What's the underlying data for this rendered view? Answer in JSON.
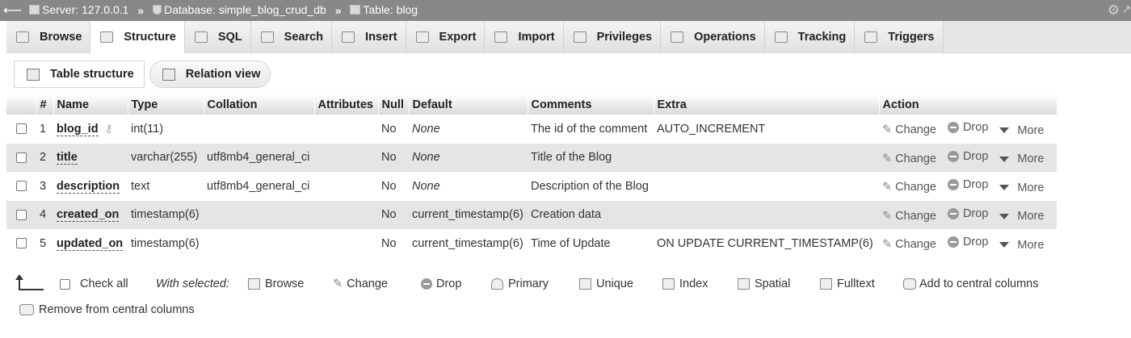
{
  "breadcrumb": {
    "back_icon": "arrow-left-icon",
    "server": "Server: 127.0.0.1",
    "database": "Database: simple_blog_crud_db",
    "table": "Table: blog",
    "separator": "»"
  },
  "tabs": [
    {
      "label": "Browse",
      "icon": "browse-icon",
      "active": false
    },
    {
      "label": "Structure",
      "icon": "structure-icon",
      "active": true
    },
    {
      "label": "SQL",
      "icon": "sql-icon",
      "active": false
    },
    {
      "label": "Search",
      "icon": "search-icon",
      "active": false
    },
    {
      "label": "Insert",
      "icon": "insert-icon",
      "active": false
    },
    {
      "label": "Export",
      "icon": "export-icon",
      "active": false
    },
    {
      "label": "Import",
      "icon": "import-icon",
      "active": false
    },
    {
      "label": "Privileges",
      "icon": "privileges-icon",
      "active": false
    },
    {
      "label": "Operations",
      "icon": "wrench-icon",
      "active": false
    },
    {
      "label": "Tracking",
      "icon": "eye-icon",
      "active": false
    },
    {
      "label": "Triggers",
      "icon": "triggers-icon",
      "active": false
    }
  ],
  "subnav": {
    "table_structure": "Table structure",
    "relation_view": "Relation view"
  },
  "table": {
    "headers": [
      "#",
      "Name",
      "Type",
      "Collation",
      "Attributes",
      "Null",
      "Default",
      "Comments",
      "Extra",
      "Action"
    ],
    "rows": [
      {
        "num": "1",
        "name": "blog_id",
        "primary_key": true,
        "type": "int(11)",
        "collation": "",
        "attributes": "",
        "null": "No",
        "default": "None",
        "default_italic": true,
        "comments": "The id of the comment",
        "extra": "AUTO_INCREMENT"
      },
      {
        "num": "2",
        "name": "title",
        "primary_key": false,
        "type": "varchar(255)",
        "collation": "utf8mb4_general_ci",
        "attributes": "",
        "null": "No",
        "default": "None",
        "default_italic": true,
        "comments": "Title of the Blog",
        "extra": ""
      },
      {
        "num": "3",
        "name": "description",
        "primary_key": false,
        "type": "text",
        "collation": "utf8mb4_general_ci",
        "attributes": "",
        "null": "No",
        "default": "None",
        "default_italic": true,
        "comments": "Description of the Blog",
        "extra": ""
      },
      {
        "num": "4",
        "name": "created_on",
        "primary_key": false,
        "type": "timestamp(6)",
        "collation": "",
        "attributes": "",
        "null": "No",
        "default": "current_timestamp(6)",
        "default_italic": false,
        "comments": "Creation data",
        "extra": ""
      },
      {
        "num": "5",
        "name": "updated_on",
        "primary_key": false,
        "type": "timestamp(6)",
        "collation": "",
        "attributes": "",
        "null": "No",
        "default": "current_timestamp(6)",
        "default_italic": false,
        "comments": "Time of Update",
        "extra": "ON UPDATE CURRENT_TIMESTAMP(6)"
      }
    ],
    "actions": {
      "change": "Change",
      "drop": "Drop",
      "more": "More"
    }
  },
  "footer": {
    "check_all": "Check all",
    "with_selected": "With selected:",
    "browse": "Browse",
    "change": "Change",
    "drop": "Drop",
    "primary": "Primary",
    "unique": "Unique",
    "index": "Index",
    "spatial": "Spatial",
    "fulltext": "Fulltext",
    "add_central": "Add to central columns",
    "remove_central": "Remove from central columns"
  },
  "colors": {
    "topbar": "#888888",
    "tab_bg": "#e6e6e6",
    "row_alt": "#e5e5e5"
  }
}
